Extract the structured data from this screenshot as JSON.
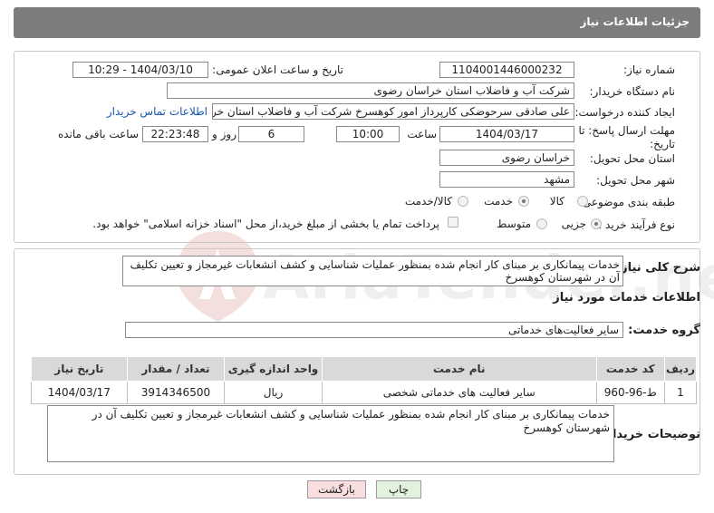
{
  "header": {
    "title": "جزئیات اطلاعات نیاز"
  },
  "watermark": {
    "text": "AriaTender.neT"
  },
  "form": {
    "need_number_label": "شماره نیاز:",
    "need_number": "1104001446000232",
    "announce_label": "تاریخ و ساعت اعلان عمومی:",
    "announce_value": "1404/03/10 - 10:29",
    "buyer_org_label": "نام دستگاه خریدار:",
    "buyer_org": "شرکت آب و فاضلاب استان خراسان رضوی",
    "creator_label": "ایجاد کننده درخواست:",
    "creator": "علی صادقی سرحوضکی کارپرداز امور کوهسرخ  شرکت آب و فاضلاب استان خراسان رضوی",
    "contact_link": "اطلاعات تماس خریدار",
    "deadline_label_1": "مهلت ارسال پاسخ: تا",
    "deadline_label_2": "تاریخ:",
    "deadline_date": "1404/03/17",
    "time_label": "ساعت",
    "deadline_time": "10:00",
    "days_value": "6",
    "days_label": "روز و",
    "remaining_time": "22:23:48",
    "remaining_label": "ساعت باقی مانده",
    "province_label": "استان محل تحویل:",
    "province": "خراسان رضوی",
    "city_label": "شهر محل تحویل:",
    "city": "مشهد",
    "category_label": "طبقه بندی موضوعی:",
    "category_options": [
      "کالا",
      "خدمت",
      "کالا/خدمت"
    ],
    "category_selected": "خدمت",
    "process_label": "نوع فرآیند خرید :",
    "process_options": [
      "جزیی",
      "متوسط"
    ],
    "process_selected": "جزیی",
    "payment_note": "پرداخت تمام یا بخشی از مبلغ خرید،از محل \"اسناد خزانه اسلامی\" خواهد بود."
  },
  "details": {
    "summary_label": "شرح کلی نیاز:",
    "summary": "خدمات پیمانکاری بر مبنای کار انجام شده بمنظور عملیات شناسایی و کشف انشعابات غیرمجاز و تعیین تکلیف آن در شهرستان کوهسرخ",
    "services_title": "اطلاعات خدمات مورد نیاز",
    "service_group_label": "گروه خدمت:",
    "service_group": "سایر فعالیت‌های خدماتی",
    "table": {
      "headers": [
        "ردیف",
        "کد خدمت",
        "نام خدمت",
        "واحد اندازه گیری",
        "تعداد / مقدار",
        "تاریخ نیاز"
      ],
      "rows": [
        [
          "1",
          "ط-96-960",
          "سایر فعالیت های خدماتی شخصی",
          "ریال",
          "3914346500",
          "1404/03/17"
        ]
      ]
    },
    "buyer_notes_label": "توضیحات خریدار:",
    "buyer_notes": "خدمات پیمانکاری بر مبنای کار انجام شده بمنظور عملیات شناسایی و کشف انشعابات غیرمجاز و تعیین تکلیف آن در شهرستان کوهسرخ"
  },
  "buttons": {
    "print": "چاپ",
    "back": "بازگشت"
  },
  "colors": {
    "header_bg": "#7d7d7d",
    "link": "#1a56b0",
    "table_header": "#d9d9d9",
    "print_btn": "#e2f2dc",
    "back_btn": "#f8dede"
  }
}
